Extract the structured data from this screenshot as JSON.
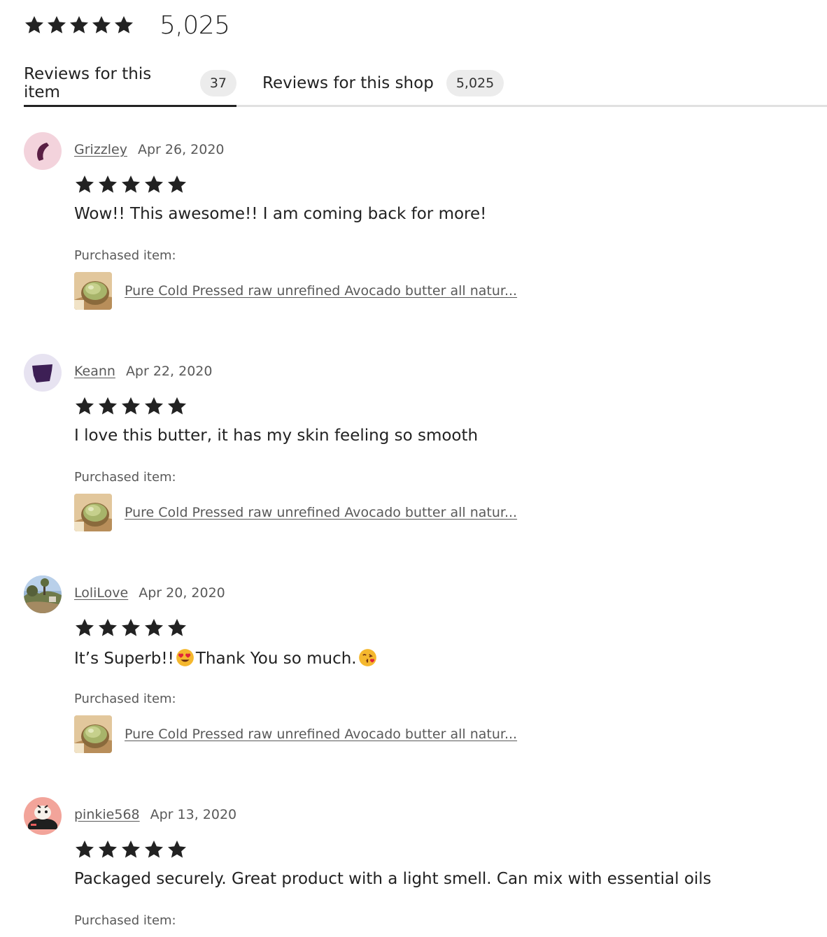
{
  "summary": {
    "rating_stars": 5,
    "count": "5,025"
  },
  "tabs": [
    {
      "label": "Reviews for this item",
      "badge": "37",
      "active": true
    },
    {
      "label": "Reviews for this shop",
      "badge": "5,025",
      "active": false
    }
  ],
  "reviews": [
    {
      "reviewer": "Grizzley",
      "date": "Apr 26, 2020",
      "stars": 5,
      "text": "Wow!! This awesome!! I am coming back for more!",
      "purchased_label": "Purchased item:",
      "product_title": "Pure Cold Pressed raw unrefined Avocado butter all natur...",
      "avatar_icon": "purple-crescent-avatar"
    },
    {
      "reviewer": "Keann",
      "date": "Apr 22, 2020",
      "stars": 5,
      "text": "I love this butter, it has my skin feeling so smooth",
      "purchased_label": "Purchased item:",
      "product_title": "Pure Cold Pressed raw unrefined Avocado butter all natur...",
      "avatar_icon": "purple-shape-avatar"
    },
    {
      "reviewer": "LoliLove",
      "date": "Apr 20, 2020",
      "stars": 5,
      "text_part1": "It’s Superb!!",
      "text_part2": "Thank You so much.",
      "emoji1": "heart-eyes-emoji",
      "emoji2": "kissing-face-emoji",
      "purchased_label": "Purchased item:",
      "product_title": "Pure Cold Pressed raw unrefined Avocado butter all natur...",
      "avatar_icon": "landscape-photo-avatar"
    },
    {
      "reviewer": "pinkie568",
      "date": "Apr 13, 2020",
      "stars": 5,
      "text": "Packaged securely. Great product with a light smell. Can mix with essential oils",
      "purchased_label": "Purchased item:",
      "avatar_icon": "cartoon-pink-avatar"
    }
  ],
  "colors": {
    "text": "#222222",
    "muted": "#595959",
    "badge_bg": "#ececec",
    "tab_rule": "#e1e1e1"
  }
}
